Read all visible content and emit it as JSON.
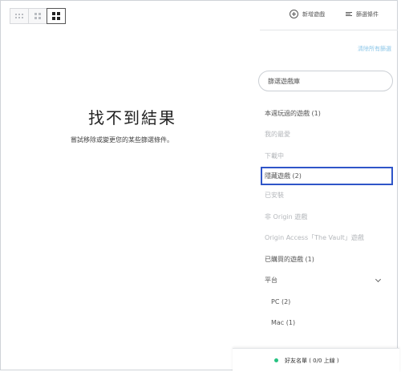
{
  "toolbar": {
    "add_game_label": "新增遊戲",
    "filter_label": "篩選條件"
  },
  "empty_state": {
    "title": "找不到結果",
    "subtitle": "嘗試移除或變更您的某些篩選條件。"
  },
  "sidebar": {
    "clear_all": "清除所有篩選",
    "search_placeholder": "篩選遊戲庫",
    "filters": [
      {
        "label": "本週玩過的遊戲 (1)",
        "state": "enabled"
      },
      {
        "label": "我的最愛",
        "state": "disabled"
      },
      {
        "label": "下載中",
        "state": "disabled"
      },
      {
        "label": "隱藏遊戲 (2)",
        "state": "highlighted"
      },
      {
        "label": "已安裝",
        "state": "disabled"
      },
      {
        "label": "非 Origin 遊戲",
        "state": "disabled"
      },
      {
        "label": "Origin Access「The Vault」遊戲",
        "state": "disabled"
      },
      {
        "label": "已購買的遊戲 (1)",
        "state": "enabled"
      }
    ],
    "platform": {
      "label": "平台",
      "options": [
        "PC (2)",
        "Mac (1)"
      ]
    }
  },
  "friends": {
    "label": "好友名單 ( 0/0 上線 )"
  },
  "colors": {
    "highlight_border": "#2f55c8",
    "online_dot": "#26c281",
    "link": "#8bc6e8"
  },
  "icons": [
    "grid-small-icon",
    "grid-medium-icon",
    "grid-large-icon",
    "plus-circle-icon",
    "filter-icon",
    "chevron-down-icon",
    "status-dot-icon"
  ]
}
